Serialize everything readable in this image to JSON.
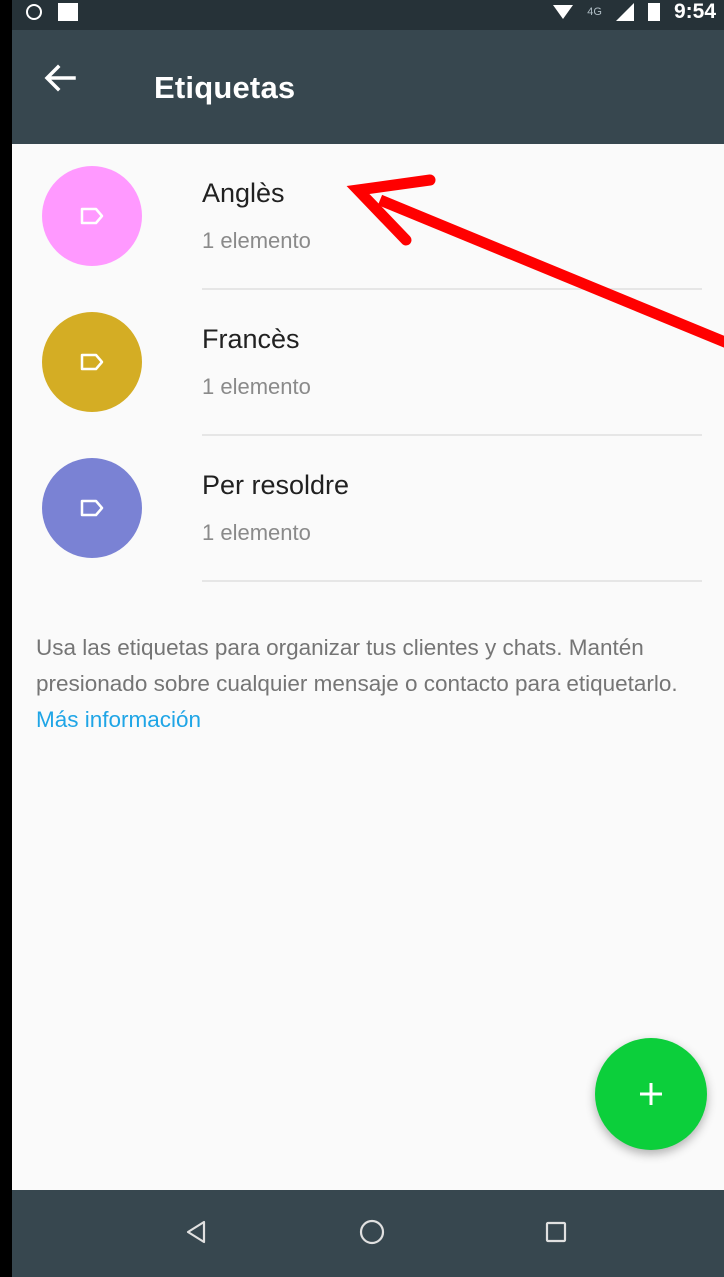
{
  "status_bar": {
    "network": "4G",
    "time": "9:54"
  },
  "app_bar": {
    "title": "Etiquetas"
  },
  "labels": [
    {
      "name": "Anglès",
      "count": "1 elemento",
      "color": "#ff99ff"
    },
    {
      "name": "Francès",
      "count": "1 elemento",
      "color": "#d4ad24"
    },
    {
      "name": "Per resoldre",
      "count": "1 elemento",
      "color": "#7a82d4"
    }
  ],
  "info": {
    "text": "Usa las etiquetas para organizar tus clientes y chats. Mantén presionado sobre cualquier mensaje o contacto para etiquetarlo.",
    "link": "Más información"
  },
  "colors": {
    "accent_fab": "#0ccf3b",
    "app_bar": "#37474f",
    "annotation_arrow": "#ff0000",
    "link": "#1fa5e6"
  },
  "icons": {
    "back": "arrow-back-icon",
    "fab": "plus-icon",
    "label": "tag-icon",
    "nav": [
      "triangle-back-icon",
      "circle-home-icon",
      "square-recents-icon"
    ]
  }
}
